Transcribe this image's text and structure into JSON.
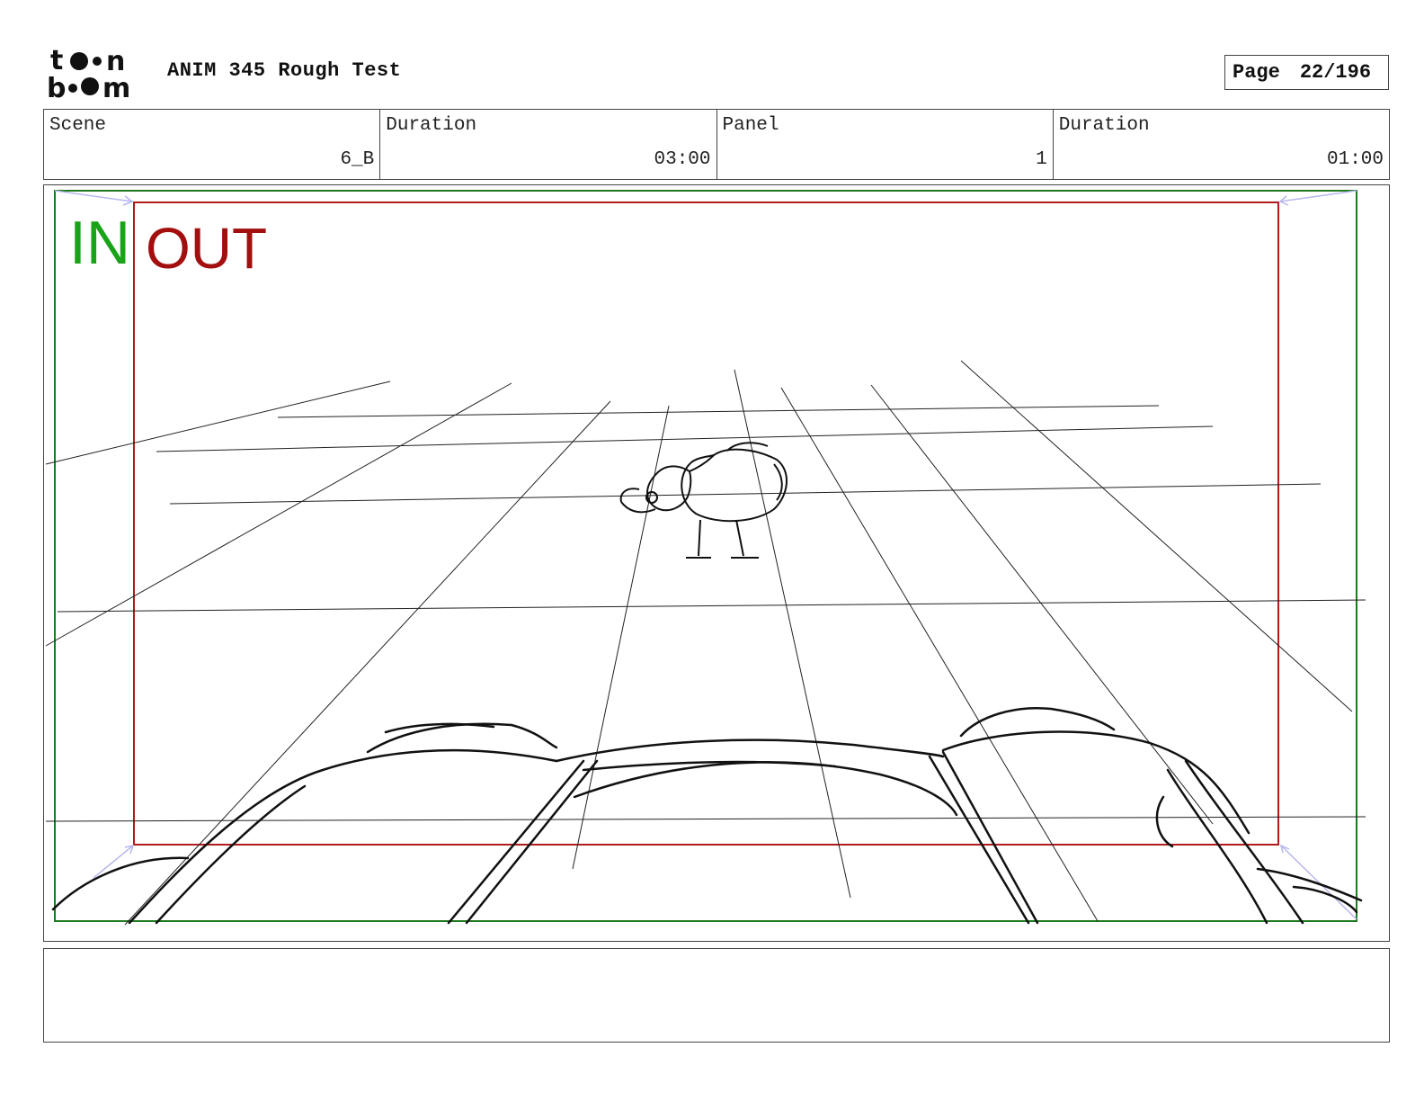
{
  "header": {
    "logo_text": "toon boom",
    "title": "ANIM 345 Rough Test",
    "page_label": "Page",
    "page_value": "22/196"
  },
  "info": {
    "scene_label": "Scene",
    "scene_value": "6_B",
    "scene_duration_label": "Duration",
    "scene_duration_value": "03:00",
    "panel_label": "Panel",
    "panel_value": "1",
    "panel_duration_label": "Duration",
    "panel_duration_value": "01:00"
  },
  "frame": {
    "in_label": "IN",
    "out_label": "OUT",
    "in_color": "#19a319",
    "out_color": "#a30f0f"
  },
  "notes": {
    "text": ""
  }
}
